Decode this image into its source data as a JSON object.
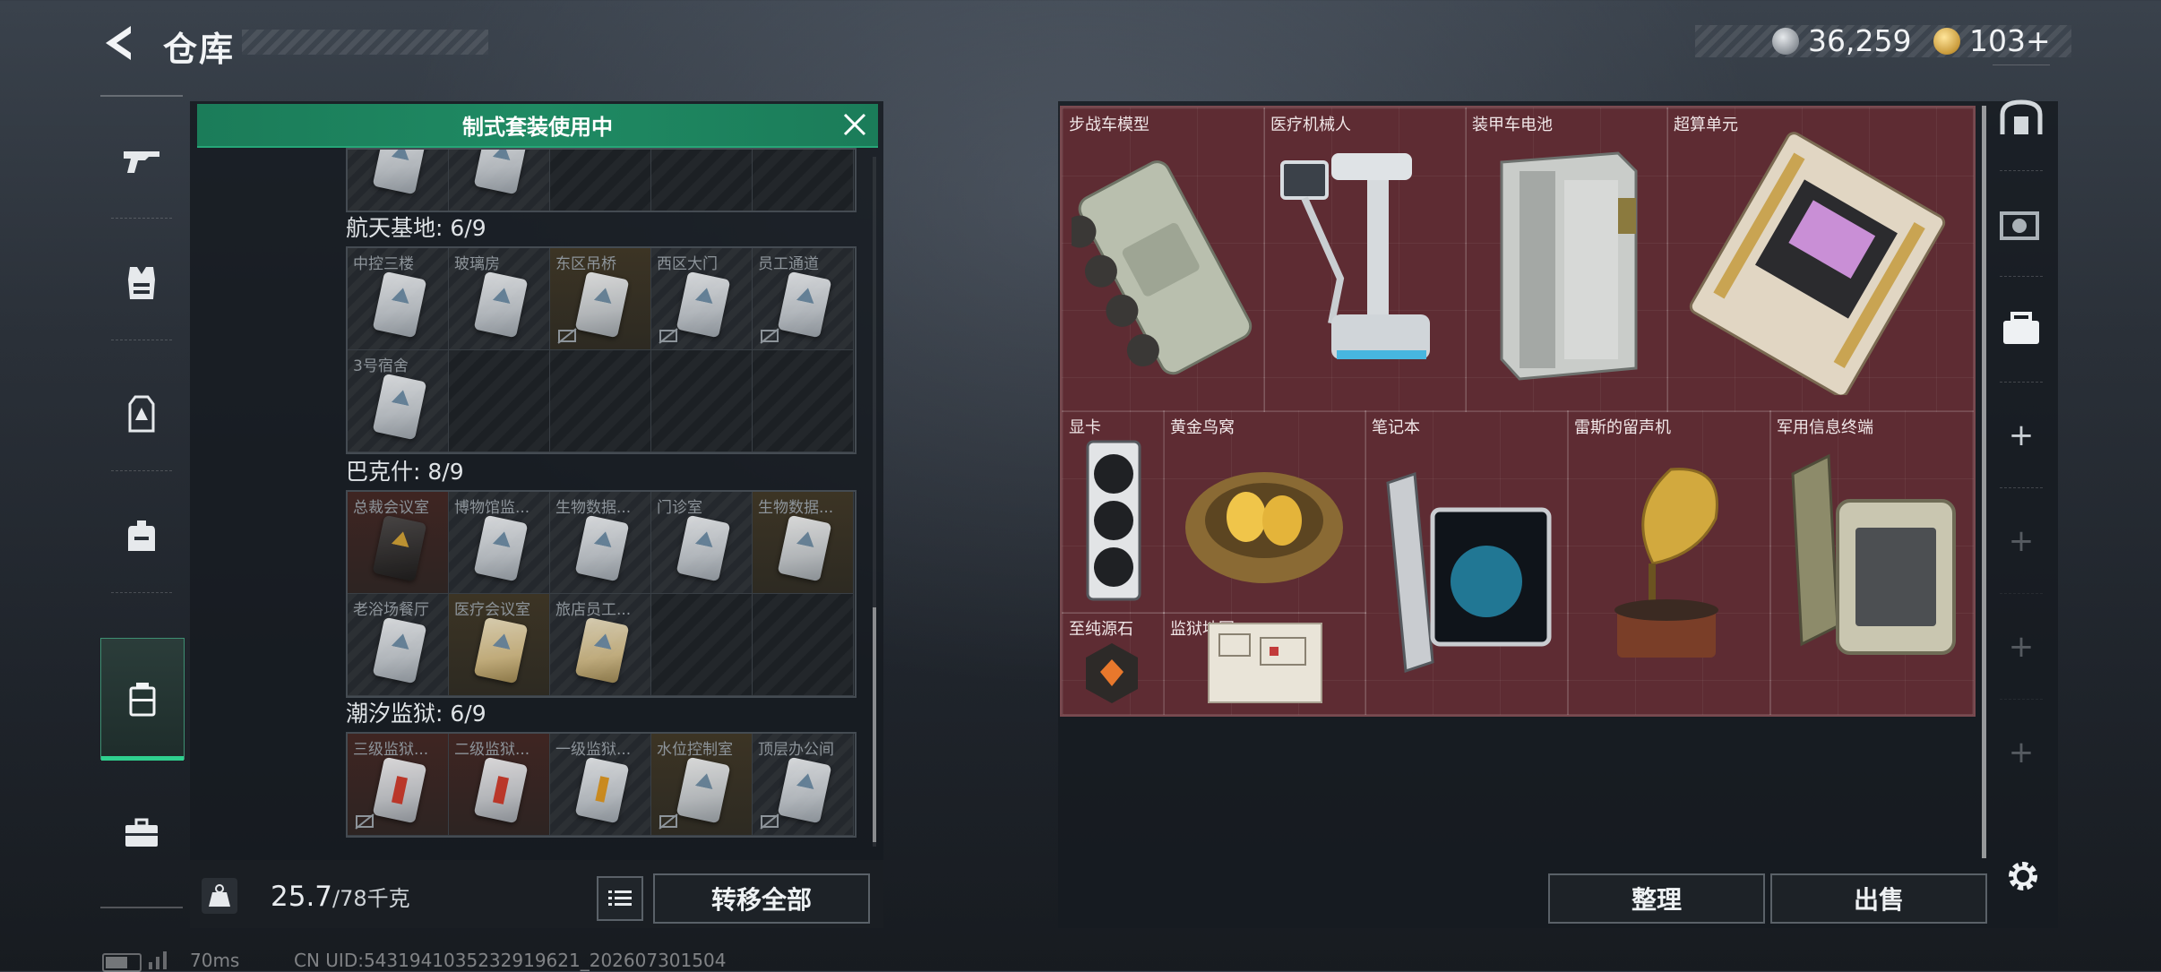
{
  "header": {
    "title": "仓库",
    "currency_primary": "36,259",
    "currency_secondary": "103+"
  },
  "left_nav": {
    "items": [
      "gun-icon",
      "armor-vest-icon",
      "chest-rig-icon",
      "backpack-icon",
      "key-case-icon",
      "medkit-icon"
    ],
    "active": "key-case-icon"
  },
  "container": {
    "banner": "制式套装使用中",
    "groups": [
      {
        "title": "航天基地: 6/9",
        "cells": [
          "中控三楼",
          "玻璃房",
          "东区吊桥",
          "西区大门",
          "员工通道",
          "3号宿舍"
        ]
      },
      {
        "title": "巴克什: 8/9",
        "cells": [
          "总裁会议室",
          "博物馆监...",
          "生物数据...",
          "门诊室",
          "生物数据...",
          "老浴场餐厅",
          "医疗会议室",
          "旅店员工..."
        ]
      },
      {
        "title": "潮汐监狱: 6/9",
        "cells": [
          "三级监狱...",
          "二级监狱...",
          "一级监狱...",
          "水位控制室",
          "顶层办公间"
        ]
      }
    ],
    "weight_current": "25.7",
    "weight_max": "/78千克",
    "transfer_all_label": "转移全部"
  },
  "stash": {
    "items": [
      "步战车模型",
      "医疗机械人",
      "装甲车电池",
      "超算单元",
      "显卡",
      "黄金鸟窝",
      "笔记本",
      "雷斯的留声机",
      "军用信息终端",
      "至纯源石",
      "监狱地图"
    ],
    "sort_label": "整理",
    "sell_label": "出售"
  },
  "right_nav": {
    "items": [
      "safe-box-icon",
      "collection-icon",
      "toolbox-icon",
      "add-icon",
      "add-icon",
      "add-icon",
      "add-icon"
    ]
  },
  "status": {
    "ping": "70ms",
    "uid": "CN UID:5431941035232919621_202607301504"
  },
  "colors": {
    "accent": "#2fd18f",
    "banner": "#1f8a63",
    "stash_bg": "#5e2c33"
  }
}
